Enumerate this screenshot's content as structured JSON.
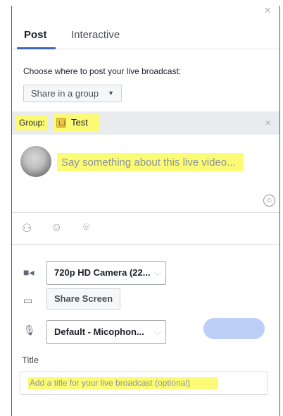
{
  "header": {
    "close_glyph": "×"
  },
  "tabs": [
    {
      "label": "Post",
      "active": true
    },
    {
      "label": "Interactive",
      "active": false
    }
  ],
  "post": {
    "prompt": "Choose where to post your live broadcast:",
    "share_select": {
      "value": "Share in a group",
      "caret": "▼"
    }
  },
  "group": {
    "label": "Group:",
    "name": "Test",
    "icon": "group-icon",
    "remove_glyph": "×"
  },
  "composer": {
    "placeholder": "Say something about this live video...",
    "emoji_icon": "emoji-icon",
    "emoji_glyph": "☺"
  },
  "toolbar": {
    "icons": [
      "tag-people-icon",
      "feeling-icon",
      "location-icon"
    ],
    "tag_glyph": "⚇",
    "feeling_glyph": "☺",
    "location_glyph": "⌾"
  },
  "devices": {
    "camera": {
      "value": "720p HD Camera (22...",
      "icon": "camera-icon",
      "icon_glyph": "■◂"
    },
    "screen": {
      "label": "Share Screen",
      "icon": "monitor-icon",
      "icon_glyph": "▭"
    },
    "microphone": {
      "value": "Default - Micophon...",
      "icon": "microphone-icon",
      "icon_glyph": "🎙"
    },
    "chevron_glyph": "⌵"
  },
  "title": {
    "label": "Title",
    "placeholder": "Add a title for your live broadcast (optional)"
  },
  "colors": {
    "accent": "#4267b2",
    "highlight": "#fbfb76",
    "go_live_disabled": "#bcd0f7",
    "group_bar": "#e9ebee"
  }
}
